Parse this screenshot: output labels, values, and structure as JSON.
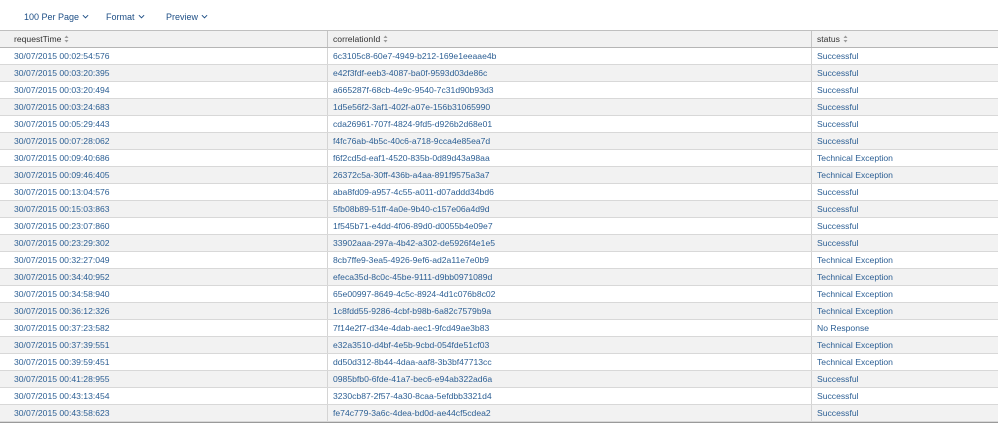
{
  "toolbar": {
    "per_page_label": "100 Per Page",
    "format_label": "Format",
    "preview_label": "Preview"
  },
  "table": {
    "columns": [
      "requestTime",
      "correlationId",
      "status"
    ],
    "rows": [
      {
        "requestTime": "30/07/2015 00:02:54:576",
        "correlationId": "6c3105c8-60e7-4949-b212-169e1eeaae4b",
        "status": "Successful"
      },
      {
        "requestTime": "30/07/2015 00:03:20:395",
        "correlationId": "e42f3fdf-eeb3-4087-ba0f-9593d03de86c",
        "status": "Successful"
      },
      {
        "requestTime": "30/07/2015 00:03:20:494",
        "correlationId": "a665287f-68cb-4e9c-9540-7c31d90b93d3",
        "status": "Successful"
      },
      {
        "requestTime": "30/07/2015 00:03:24:683",
        "correlationId": "1d5e56f2-3af1-402f-a07e-156b31065990",
        "status": "Successful"
      },
      {
        "requestTime": "30/07/2015 00:05:29:443",
        "correlationId": "cda26961-707f-4824-9fd5-d926b2d68e01",
        "status": "Successful"
      },
      {
        "requestTime": "30/07/2015 00:07:28:062",
        "correlationId": "f4fc76ab-4b5c-40c6-a718-9cca4e85ea7d",
        "status": "Successful"
      },
      {
        "requestTime": "30/07/2015 00:09:40:686",
        "correlationId": "f6f2cd5d-eaf1-4520-835b-0d89d43a98aa",
        "status": "Technical Exception"
      },
      {
        "requestTime": "30/07/2015 00:09:46:405",
        "correlationId": "26372c5a-30ff-436b-a4aa-891f9575a3a7",
        "status": "Technical Exception"
      },
      {
        "requestTime": "30/07/2015 00:13:04:576",
        "correlationId": "aba8fd09-a957-4c55-a011-d07addd34bd6",
        "status": "Successful"
      },
      {
        "requestTime": "30/07/2015 00:15:03:863",
        "correlationId": "5fb08b89-51ff-4a0e-9b40-c157e06a4d9d",
        "status": "Successful"
      },
      {
        "requestTime": "30/07/2015 00:23:07:860",
        "correlationId": "1f545b71-e4dd-4f06-89d0-d0055b4e09e7",
        "status": "Successful"
      },
      {
        "requestTime": "30/07/2015 00:23:29:302",
        "correlationId": "33902aaa-297a-4b42-a302-de5926f4e1e5",
        "status": "Successful"
      },
      {
        "requestTime": "30/07/2015 00:32:27:049",
        "correlationId": "8cb7ffe9-3ea5-4926-9ef6-ad2a11e7e0b9",
        "status": "Technical Exception"
      },
      {
        "requestTime": "30/07/2015 00:34:40:952",
        "correlationId": "efeca35d-8c0c-45be-9111-d9bb0971089d",
        "status": "Technical Exception"
      },
      {
        "requestTime": "30/07/2015 00:34:58:940",
        "correlationId": "65e00997-8649-4c5c-8924-4d1c076b8c02",
        "status": "Technical Exception"
      },
      {
        "requestTime": "30/07/2015 00:36:12:326",
        "correlationId": "1c8fdd55-9286-4cbf-b98b-6a82c7579b9a",
        "status": "Technical Exception"
      },
      {
        "requestTime": "30/07/2015 00:37:23:582",
        "correlationId": "7f14e2f7-d34e-4dab-aec1-9fcd49ae3b83",
        "status": "No Response"
      },
      {
        "requestTime": "30/07/2015 00:37:39:551",
        "correlationId": "e32a3510-d4bf-4e5b-9cbd-054fde51cf03",
        "status": "Technical Exception"
      },
      {
        "requestTime": "30/07/2015 00:39:59:451",
        "correlationId": "dd50d312-8b44-4daa-aaf8-3b3bf47713cc",
        "status": "Technical Exception"
      },
      {
        "requestTime": "30/07/2015 00:41:28:955",
        "correlationId": "0985bfb0-6fde-41a7-bec6-e94ab322ad6a",
        "status": "Successful"
      },
      {
        "requestTime": "30/07/2015 00:43:13:454",
        "correlationId": "3230cb87-2f57-4a30-8caa-5efdbb3321d4",
        "status": "Successful"
      },
      {
        "requestTime": "30/07/2015 00:43:58:623",
        "correlationId": "fe74c779-3a6c-4dea-bd0d-ae44cf5cdea2",
        "status": "Successful"
      }
    ]
  },
  "colors": {
    "link": "#2c5f94",
    "toolbar_link": "#1e4f86",
    "row_alt": "#f2f2f2",
    "header_bg": "#f1f1f1"
  },
  "icons": {
    "sort": "sort-icon",
    "dropdown": "chevron-down-icon"
  }
}
